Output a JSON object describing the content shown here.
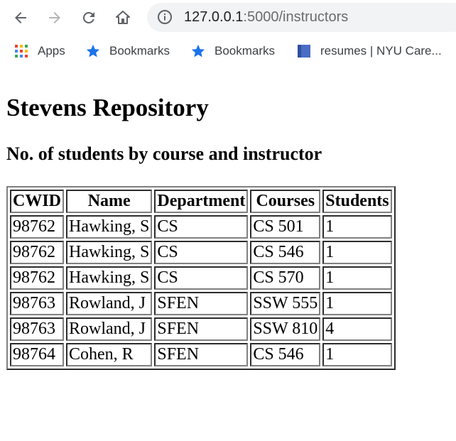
{
  "browser": {
    "url_host": "127.0.0.1",
    "url_path": ":5000/instructors",
    "icons": {
      "back": "back-arrow-icon",
      "forward": "forward-arrow-icon",
      "reload": "reload-icon",
      "home": "home-icon",
      "info": "info-icon"
    }
  },
  "bookmarks": [
    {
      "label": "Apps",
      "icon": "apps-grid-icon"
    },
    {
      "label": "Bookmarks",
      "icon": "star-icon"
    },
    {
      "label": "Bookmarks",
      "icon": "star-icon"
    },
    {
      "label": "resumes | NYU Care...",
      "icon": "bookmark-page-icon"
    }
  ],
  "page": {
    "title": "Stevens Repository",
    "subtitle": "No. of students by course and instructor",
    "table": {
      "headers": [
        "CWID",
        "Name",
        "Department",
        "Courses",
        "Students"
      ],
      "rows": [
        [
          "98762",
          "Hawking, S",
          "CS",
          "CS 501",
          "1"
        ],
        [
          "98762",
          "Hawking, S",
          "CS",
          "CS 546",
          "1"
        ],
        [
          "98762",
          "Hawking, S",
          "CS",
          "CS 570",
          "1"
        ],
        [
          "98763",
          "Rowland, J",
          "SFEN",
          "SSW 555",
          "1"
        ],
        [
          "98763",
          "Rowland, J",
          "SFEN",
          "SSW 810",
          "4"
        ],
        [
          "98764",
          "Cohen, R",
          "SFEN",
          "CS 546",
          "1"
        ]
      ]
    }
  },
  "colors": {
    "star": "#1a73e8",
    "omnibox_bg": "#f1f3f4",
    "icon_gray": "#5f6368"
  }
}
